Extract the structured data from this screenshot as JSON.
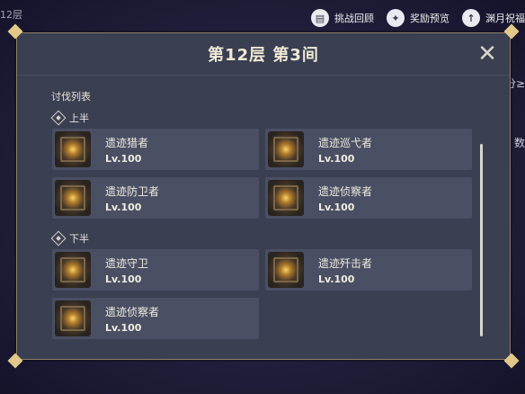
{
  "background": {
    "top_left_text": "12层",
    "top_buttons": [
      {
        "icon": "history-icon",
        "label": "挑战回顾"
      },
      {
        "icon": "star-icon",
        "label": "奖励预览"
      },
      {
        "icon": "arrow-up-icon",
        "label": "渊月祝福"
      }
    ],
    "right_edge_texts": [
      "分≥",
      "数"
    ]
  },
  "panel": {
    "title": "第12层 第3间",
    "section_title": "讨伐列表",
    "first_half": {
      "label": "上半",
      "enemies": [
        {
          "name": "遗迹猎者",
          "level": "Lv.100"
        },
        {
          "name": "遗迹巡弋者",
          "level": "Lv.100"
        },
        {
          "name": "遗迹防卫者",
          "level": "Lv.100"
        },
        {
          "name": "遗迹侦察者",
          "level": "Lv.100"
        }
      ]
    },
    "second_half": {
      "label": "下半",
      "enemies": [
        {
          "name": "遗迹守卫",
          "level": "Lv.100"
        },
        {
          "name": "遗迹歼击者",
          "level": "Lv.100"
        },
        {
          "name": "遗迹侦察者",
          "level": "Lv.100"
        }
      ]
    }
  }
}
